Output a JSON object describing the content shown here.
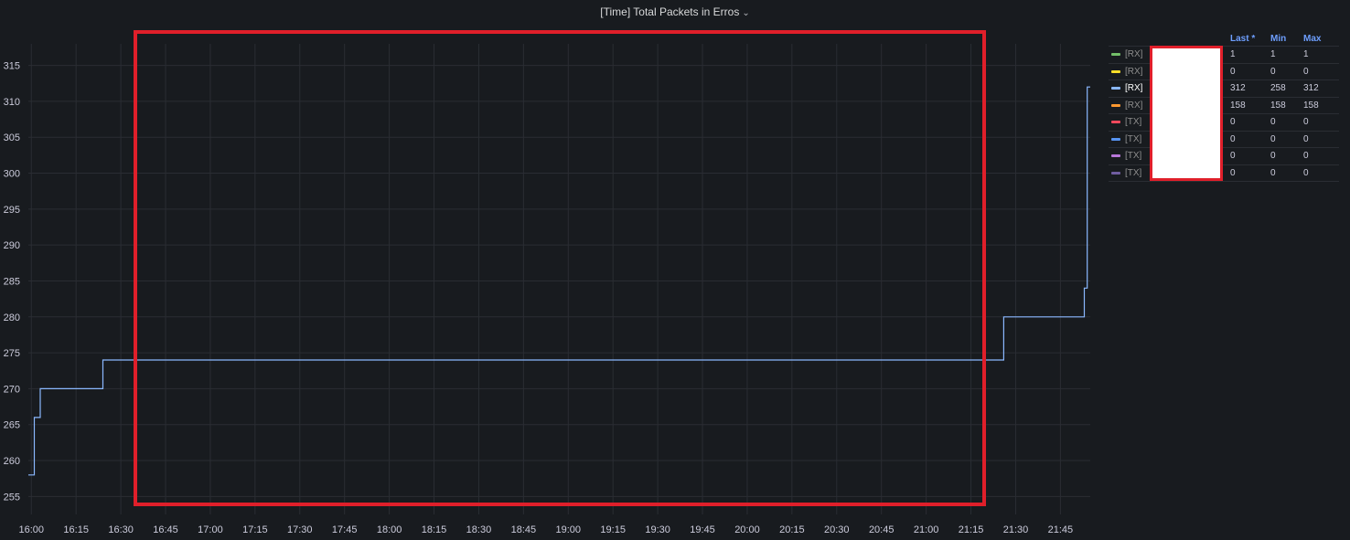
{
  "panel": {
    "title": "[Time] Total Packets in Erros",
    "chevron": "⌄"
  },
  "colors": {
    "background": "#181b1f",
    "grid": "#2a2d33",
    "series_line": "#8ab8ff",
    "axis_text": "#ccccdc",
    "annotation_box": "#e01f2a"
  },
  "legend": {
    "headers": {
      "name": "",
      "last": "Last *",
      "min": "Min",
      "max": "Max"
    },
    "rows": [
      {
        "label": "[RX]",
        "color": "#73bf69",
        "last": "1",
        "min": "1",
        "max": "1",
        "active": false
      },
      {
        "label": "[RX]",
        "color": "#fade2a",
        "last": "0",
        "min": "0",
        "max": "0",
        "active": false
      },
      {
        "label": "[RX]",
        "color": "#8ab8ff",
        "last": "312",
        "min": "258",
        "max": "312",
        "active": true
      },
      {
        "label": "[RX]",
        "color": "#ff9830",
        "last": "158",
        "min": "158",
        "max": "158",
        "active": false
      },
      {
        "label": "[TX]",
        "color": "#f2495c",
        "last": "0",
        "min": "0",
        "max": "0",
        "active": false
      },
      {
        "label": "[TX]",
        "color": "#5794f2",
        "last": "0",
        "min": "0",
        "max": "0",
        "active": false
      },
      {
        "label": "[TX]",
        "color": "#b877d9",
        "last": "0",
        "min": "0",
        "max": "0",
        "active": false
      },
      {
        "label": "[TX]",
        "color": "#705da0",
        "last": "0",
        "min": "0",
        "max": "0",
        "active": false
      }
    ]
  },
  "chart_data": {
    "type": "line",
    "title": "[Time] Total Packets in Erros",
    "xlabel": "",
    "ylabel": "",
    "ylim": [
      252.5,
      318
    ],
    "xlim": [
      "15:59",
      "21:55"
    ],
    "y_ticks": [
      255,
      260,
      265,
      270,
      275,
      280,
      285,
      290,
      295,
      300,
      305,
      310,
      315
    ],
    "x_ticks": [
      "16:00",
      "16:15",
      "16:30",
      "16:45",
      "17:00",
      "17:15",
      "17:30",
      "17:45",
      "18:00",
      "18:15",
      "18:30",
      "18:45",
      "19:00",
      "19:15",
      "19:30",
      "19:45",
      "20:00",
      "20:15",
      "20:30",
      "20:45",
      "21:00",
      "21:15",
      "21:30",
      "21:45"
    ],
    "grid": true,
    "series": [
      {
        "x": [
          "15:59",
          "16:01",
          "16:01",
          "16:03",
          "16:03",
          "16:24",
          "16:24",
          "21:26",
          "21:26",
          "21:53",
          "21:53",
          "21:54",
          "21:54",
          "21:55"
        ],
        "values": [
          258,
          258,
          266,
          266,
          270,
          270,
          274,
          274,
          280,
          280,
          284,
          284,
          312,
          312
        ],
        "color": "#8ab8ff"
      }
    ]
  }
}
